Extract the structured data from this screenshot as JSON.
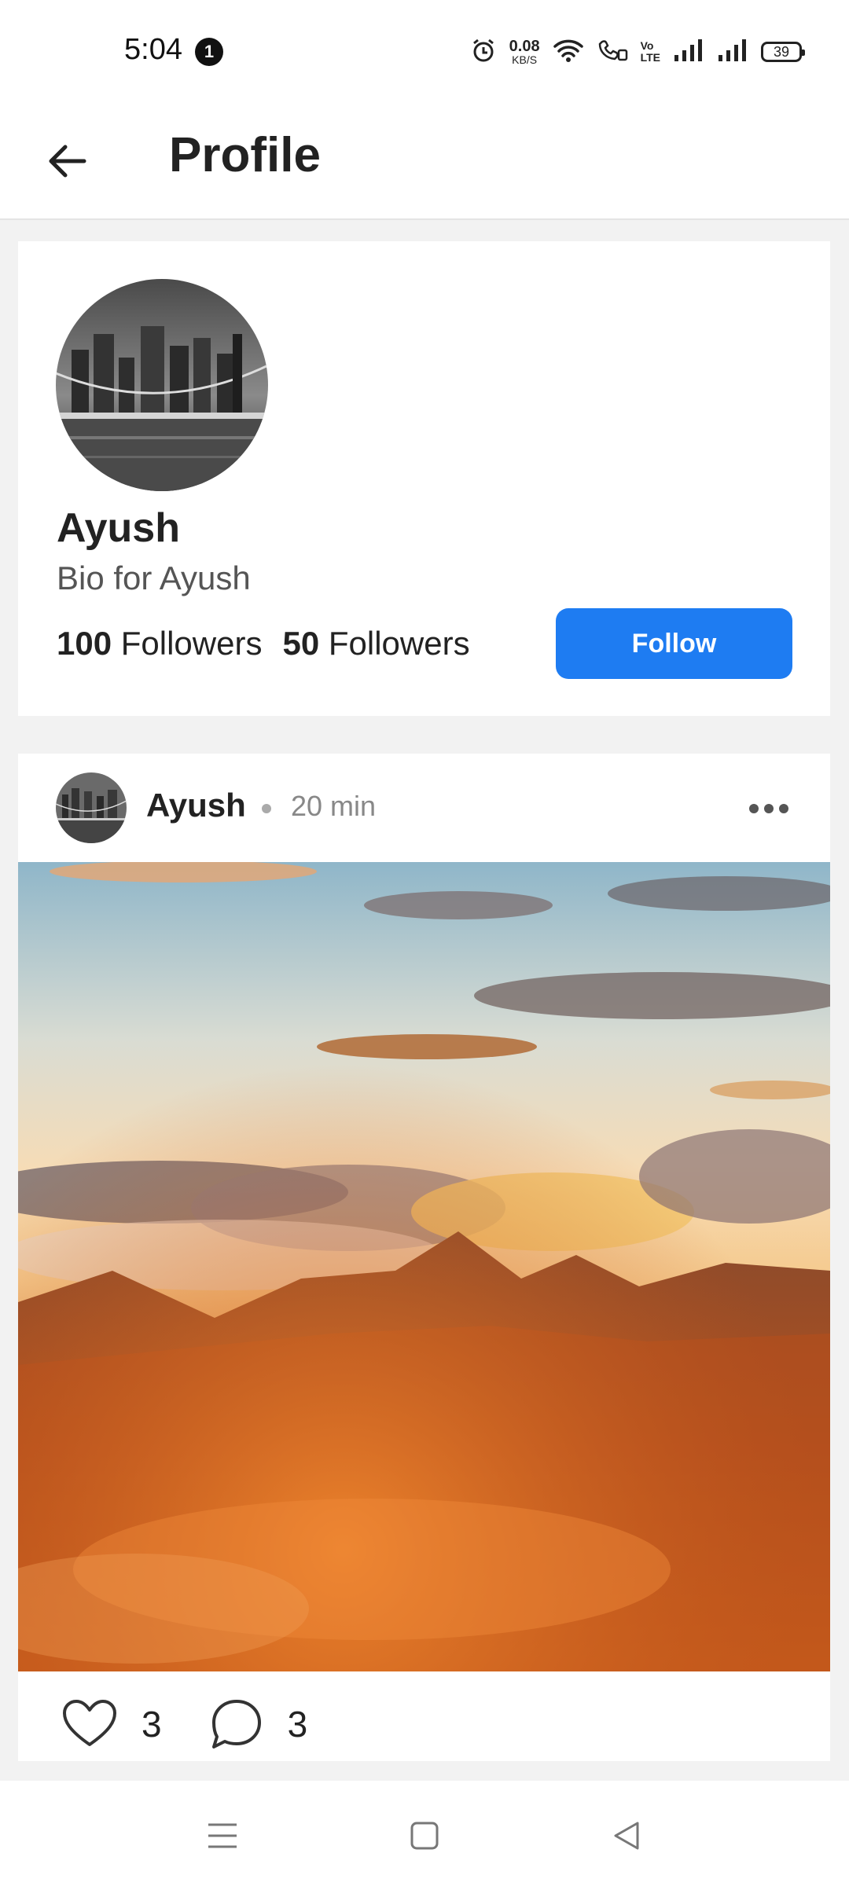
{
  "status_bar": {
    "time": "5:04",
    "notification_count": "1",
    "net_speed_value": "0.08",
    "net_speed_unit": "KB/S",
    "volte_top": "Vo",
    "volte_bottom": "LTE",
    "battery": "39"
  },
  "app_bar": {
    "title": "Profile"
  },
  "profile": {
    "name": "Ayush",
    "bio": "Bio for Ayush",
    "followers_count": "100",
    "followers_label": "Followers",
    "following_count": "50",
    "following_label": "Followers",
    "follow_button": "Follow"
  },
  "post": {
    "author": "Ayush",
    "time": "20 min",
    "likes": "3",
    "comments": "3"
  },
  "colors": {
    "accent": "#1e7cf2",
    "background": "#f2f2f2"
  }
}
